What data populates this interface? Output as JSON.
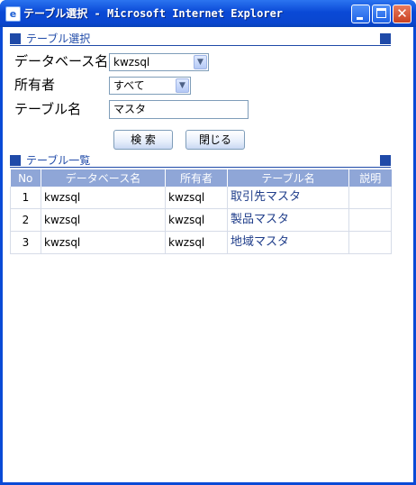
{
  "window": {
    "title": "テーブル選択 - Microsoft Internet Explorer",
    "icon": "ie-page-icon",
    "controls": [
      "minimize",
      "maximize",
      "close"
    ]
  },
  "search_section": {
    "title": "テーブル選択",
    "database_label": "データベース名",
    "database_value": "kwzsql",
    "owner_label": "所有者",
    "owner_value": "すべて",
    "table_label": "テーブル名",
    "table_value": "マスタ",
    "search_button": "検 索",
    "close_button": "閉じる"
  },
  "list_section": {
    "title": "テーブル一覧",
    "columns": [
      "No",
      "データベース名",
      "所有者",
      "テーブル名",
      "説明"
    ],
    "rows": [
      {
        "no": "1",
        "database": "kwzsql",
        "owner": "kwzsql",
        "table": "取引先マスタ",
        "description": ""
      },
      {
        "no": "2",
        "database": "kwzsql",
        "owner": "kwzsql",
        "table": "製品マスタ",
        "description": ""
      },
      {
        "no": "3",
        "database": "kwzsql",
        "owner": "kwzsql",
        "table": "地域マスタ",
        "description": ""
      }
    ]
  },
  "colors": {
    "titlebar": "#0a4ad6",
    "section_accent": "#1f4aa8",
    "grid_header": "#8fa6d7",
    "link_text": "#1f3d8a"
  }
}
